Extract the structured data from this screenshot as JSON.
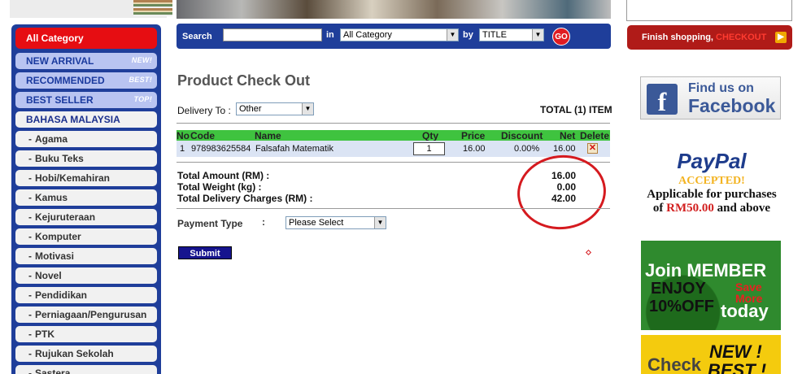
{
  "sidebar": {
    "items": [
      {
        "label": "All Category",
        "kind": "all",
        "tag": ""
      },
      {
        "label": "NEW ARRIVAL",
        "kind": "hl",
        "tag": "NEW!"
      },
      {
        "label": "RECOMMENDED",
        "kind": "hl",
        "tag": "BEST!"
      },
      {
        "label": "BEST SELLER",
        "kind": "hl",
        "tag": "TOP!"
      },
      {
        "label": "BAHASA MALAYSIA",
        "kind": "section",
        "tag": ""
      },
      {
        "label": "Agama",
        "kind": "sub",
        "tag": ""
      },
      {
        "label": "Buku Teks",
        "kind": "sub",
        "tag": ""
      },
      {
        "label": "Hobi/Kemahiran",
        "kind": "sub",
        "tag": ""
      },
      {
        "label": "Kamus",
        "kind": "sub",
        "tag": ""
      },
      {
        "label": "Kejuruteraan",
        "kind": "sub",
        "tag": ""
      },
      {
        "label": "Komputer",
        "kind": "sub",
        "tag": ""
      },
      {
        "label": "Motivasi",
        "kind": "sub",
        "tag": ""
      },
      {
        "label": "Novel",
        "kind": "sub",
        "tag": ""
      },
      {
        "label": "Pendidikan",
        "kind": "sub",
        "tag": ""
      },
      {
        "label": "Perniagaan/Pengurusan",
        "kind": "sub",
        "tag": ""
      },
      {
        "label": "PTK",
        "kind": "sub",
        "tag": ""
      },
      {
        "label": "Rujukan Sekolah",
        "kind": "sub",
        "tag": ""
      },
      {
        "label": "Sastera",
        "kind": "sub",
        "tag": ""
      }
    ]
  },
  "search": {
    "label": "Search",
    "value": "",
    "in_label": "in",
    "category_value": "All Category",
    "by_label": "by",
    "by_value": "TITLE",
    "go_label": "GO"
  },
  "checkout": {
    "title": "Product Check Out",
    "delivery_label": "Delivery To :",
    "delivery_value": "Other",
    "total_items": "TOTAL (1) ITEM",
    "columns": {
      "no": "No",
      "code": "Code",
      "name": "Name",
      "qty": "Qty",
      "price": "Price",
      "discount": "Discount",
      "net": "Net",
      "delete": "Delete"
    },
    "row": {
      "no": "1",
      "code": "978983625584",
      "name": "Falsafah Matematik",
      "qty": "1",
      "price": "16.00",
      "discount": "0.00%",
      "net": "16.00"
    },
    "totals": {
      "amount_label": "Total Amount (RM) :",
      "amount_value": "16.00",
      "weight_label": "Total Weight (kg) :",
      "weight_value": "0.00",
      "delivery_label": "Total Delivery Charges (RM) :",
      "delivery_value": "42.00"
    },
    "payment_label": "Payment Type",
    "payment_colon": ":",
    "payment_value": "Please Select",
    "submit_label": "Submit"
  },
  "right": {
    "finish_text": "Finish shopping,",
    "finish_checkout": "CHECKOUT",
    "fb_line1": "Find us on",
    "fb_line2": "Facebook",
    "fb_logo": "f",
    "paypal_logo": "PayPal",
    "paypal_accepted": "ACCEPTED!",
    "paypal_line1": "Applicable for purchases",
    "paypal_line2_pre": "of",
    "paypal_amount": "RM50.00",
    "paypal_line2_post": "and above",
    "member_line1": "Join MEMBER",
    "member_enjoy": "ENJOY",
    "member_off": "10%OFF",
    "member_save": "Save More",
    "member_today": "today",
    "nb_check": "Check",
    "nb_new": "NEW !",
    "nb_best": "BEST !"
  },
  "colors": {
    "nav_blue": "#1f3e9a",
    "alert_red": "#e60d12",
    "table_green": "#3fc33f",
    "row_blue": "#dbe4f4",
    "annotation_red": "#d51a1f"
  }
}
